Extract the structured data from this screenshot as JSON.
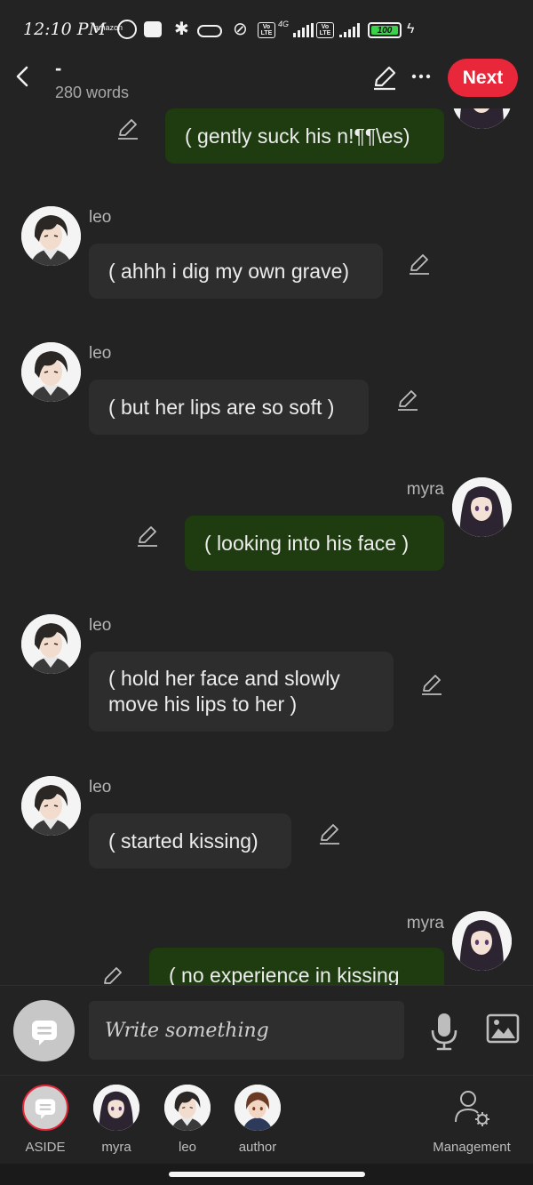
{
  "status_bar": {
    "time": "12:10 PM",
    "battery": "100",
    "network": "4G"
  },
  "header": {
    "title": "-",
    "word_count": "280 words",
    "next_label": "Next"
  },
  "messages": [
    {
      "side": "right",
      "sender": "myra",
      "text": "( gently suck his n!¶¶\\es)"
    },
    {
      "side": "left",
      "sender": "leo",
      "text": "( ahhh i dig my own grave)"
    },
    {
      "side": "left",
      "sender": "leo",
      "text": "( but her lips are so soft )"
    },
    {
      "side": "right",
      "sender": "myra",
      "text": "( looking into his face )"
    },
    {
      "side": "left",
      "sender": "leo",
      "text": "( hold her face and slowly move his lips to her )"
    },
    {
      "side": "left",
      "sender": "leo",
      "text": "( started kissing)"
    },
    {
      "side": "right",
      "sender": "myra",
      "text": "( no experience in kissing"
    }
  ],
  "composer": {
    "placeholder": "Write something"
  },
  "bottom_nav": {
    "items": [
      {
        "label": "ASIDE"
      },
      {
        "label": "myra"
      },
      {
        "label": "leo"
      },
      {
        "label": "author"
      },
      {
        "label": "Management"
      }
    ]
  },
  "colors": {
    "background": "#232323",
    "accent": "#e8283a",
    "right_bubble": "#1f3c10",
    "left_bubble": "#2d2d2d"
  }
}
